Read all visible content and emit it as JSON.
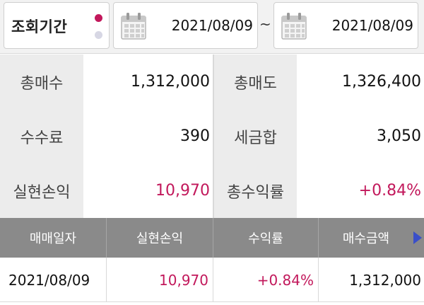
{
  "period": {
    "label": "조회기간",
    "from": "2021/08/09",
    "separator": "~",
    "to": "2021/08/09"
  },
  "summary": {
    "total_buy_label": "총매수",
    "total_buy": "1,312,000",
    "total_sell_label": "총매도",
    "total_sell": "1,326,400",
    "fee_label": "수수료",
    "fee": "390",
    "tax_label": "세금합",
    "tax": "3,050",
    "realized_pl_label": "실현손익",
    "realized_pl": "10,970",
    "total_return_label": "총수익률",
    "total_return": "+0.84%"
  },
  "table": {
    "columns": [
      "매매일자",
      "실현손익",
      "수익률",
      "매수금액"
    ],
    "rows": [
      {
        "date": "2021/08/09",
        "realized_pl": "10,970",
        "return": "+0.84%",
        "buy_amount": "1,312,000"
      }
    ]
  },
  "colors": {
    "accent": "#c2185b",
    "header_bg": "#8a8a8a",
    "label_bg": "#ececec",
    "arrow": "#3a4fc9"
  },
  "icons": [
    "calendar-icon",
    "scroll-right-icon"
  ]
}
